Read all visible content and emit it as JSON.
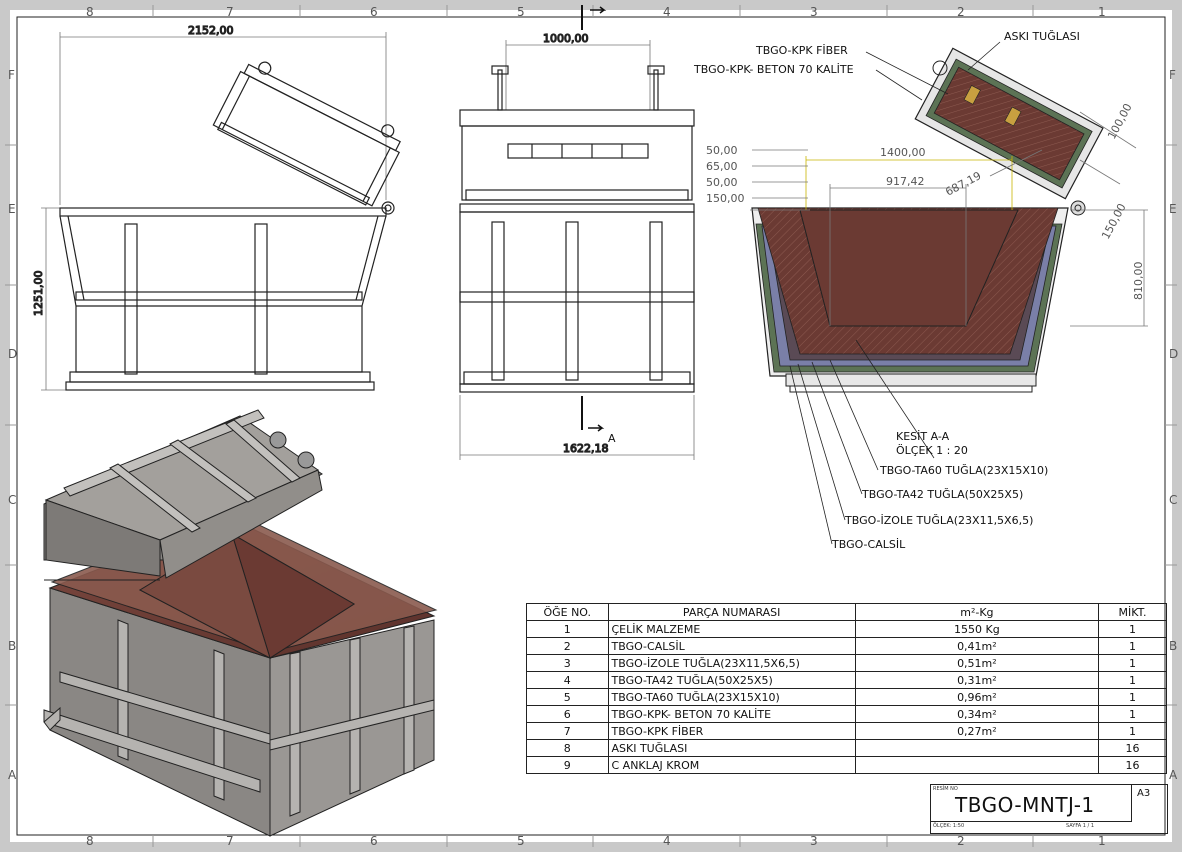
{
  "zones": {
    "columns": [
      "8",
      "7",
      "6",
      "5",
      "4",
      "3",
      "2",
      "1"
    ],
    "rows": [
      "F",
      "E",
      "D",
      "C",
      "B",
      "A"
    ]
  },
  "dimensions": {
    "side_width": "2152,00",
    "side_height": "1251,00",
    "front_top": "1000,00",
    "front_bottom": "1622,18",
    "section_top_width": "1400,00",
    "section_inner_width": "917,42",
    "section_slope": "687,19",
    "section_height": "810,00",
    "section_lid_thk": "100,00",
    "section_lid_side": "150,00",
    "layer_50a": "50,00",
    "layer_65": "65,00",
    "layer_50b": "50,00",
    "layer_150": "150,00"
  },
  "section_marker": "A",
  "section_title": "KESİT A-A",
  "section_scale": "ÖLÇEK 1 : 20",
  "callouts": {
    "fiber": "TBGO-KPK FİBER",
    "beton": "TBGO-KPK- BETON 70 KALİTE",
    "aski": "ASKI TUĞLASI",
    "ta60": "TBGO-TA60 TUĞLA(23X15X10)",
    "ta42": "TBGO-TA42 TUĞLA(50X25X5)",
    "izole": "TBGO-İZOLE TUĞLA(23X11,5X6,5)",
    "calsil": "TBGO-CALSİL"
  },
  "bom": {
    "headers": {
      "no": "ÖĞE NO.",
      "part": "PARÇA NUMARASI",
      "qty": "m²-Kg",
      "count": "MİKT."
    },
    "rows": [
      {
        "no": "1",
        "part": "ÇELİK MALZEME",
        "qty": "1550 Kg",
        "count": "1"
      },
      {
        "no": "2",
        "part": "TBGO-CALSİL",
        "qty": "0,41m²",
        "count": "1"
      },
      {
        "no": "3",
        "part": "TBGO-İZOLE TUĞLA(23X11,5X6,5)",
        "qty": "0,51m²",
        "count": "1"
      },
      {
        "no": "4",
        "part": "TBGO-TA42 TUĞLA(50X25X5)",
        "qty": "0,31m²",
        "count": "1"
      },
      {
        "no": "5",
        "part": "TBGO-TA60 TUĞLA(23X15X10)",
        "qty": "0,96m²",
        "count": "1"
      },
      {
        "no": "6",
        "part": "TBGO-KPK- BETON 70 KALİTE",
        "qty": "0,34m²",
        "count": "1"
      },
      {
        "no": "7",
        "part": "TBGO-KPK FİBER",
        "qty": "0,27m²",
        "count": "1"
      },
      {
        "no": "8",
        "part": "ASKI TUĞLASI",
        "qty": "",
        "count": "16"
      },
      {
        "no": "9",
        "part": "C ANKLAJ KROM",
        "qty": "",
        "count": "16"
      }
    ]
  },
  "title_block": {
    "drawing_label": "RESİM NO",
    "drawing_number": "TBGO-MNTJ-1",
    "size": "A3",
    "scale_label": "ÖLÇEK: 1:50",
    "sheet_label": "SAYFA 1 / 1"
  },
  "colors": {
    "refractory": "#6b3a33",
    "insulation": "#7a7fa8",
    "calsil": "#5c7355",
    "steel": "#8a8784",
    "dim_lines": "#666666",
    "highlight": "#c8b400"
  }
}
